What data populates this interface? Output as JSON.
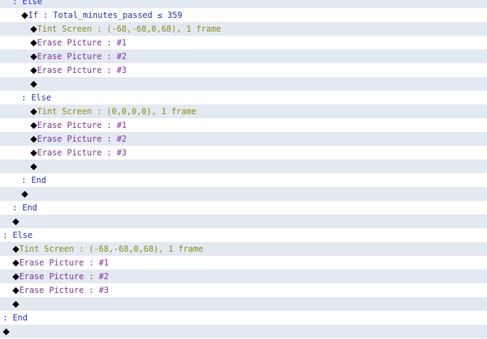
{
  "colors": {
    "row_shade": "#e3e9f1",
    "flow": "#2030c8",
    "tint": "#8a8a10",
    "erase": "#8030a0"
  },
  "events": [
    {
      "indent": 1,
      "type": "branch",
      "text": ": Else"
    },
    {
      "indent": 2,
      "type": "if",
      "text": "If : Total_minutes_passed ≤ 359"
    },
    {
      "indent": 3,
      "type": "tint",
      "text": "Tint Screen : (-68,-68,0,68), 1 frame"
    },
    {
      "indent": 3,
      "type": "erase",
      "text": "Erase Picture : #1"
    },
    {
      "indent": 3,
      "type": "erase",
      "text": "Erase Picture : #2"
    },
    {
      "indent": 3,
      "type": "erase",
      "text": "Erase Picture : #3"
    },
    {
      "indent": 3,
      "type": "empty",
      "text": ""
    },
    {
      "indent": 2,
      "type": "branch",
      "text": ": Else"
    },
    {
      "indent": 3,
      "type": "tint",
      "text": "Tint Screen : (0,0,0,0), 1 frame"
    },
    {
      "indent": 3,
      "type": "erase",
      "text": "Erase Picture : #1"
    },
    {
      "indent": 3,
      "type": "erase",
      "text": "Erase Picture : #2"
    },
    {
      "indent": 3,
      "type": "erase",
      "text": "Erase Picture : #3"
    },
    {
      "indent": 3,
      "type": "empty",
      "text": ""
    },
    {
      "indent": 2,
      "type": "branch",
      "text": ": End"
    },
    {
      "indent": 2,
      "type": "empty",
      "text": ""
    },
    {
      "indent": 1,
      "type": "branch",
      "text": ": End"
    },
    {
      "indent": 1,
      "type": "empty",
      "text": ""
    },
    {
      "indent": 0,
      "type": "branch",
      "text": ": Else"
    },
    {
      "indent": 1,
      "type": "tint",
      "text": "Tint Screen : (-68,-68,0,68), 1 frame"
    },
    {
      "indent": 1,
      "type": "erase",
      "text": "Erase Picture : #1"
    },
    {
      "indent": 1,
      "type": "erase",
      "text": "Erase Picture : #2"
    },
    {
      "indent": 1,
      "type": "erase",
      "text": "Erase Picture : #3"
    },
    {
      "indent": 1,
      "type": "empty",
      "text": ""
    },
    {
      "indent": 0,
      "type": "branch",
      "text": ": End"
    },
    {
      "indent": 0,
      "type": "empty",
      "text": ""
    }
  ]
}
